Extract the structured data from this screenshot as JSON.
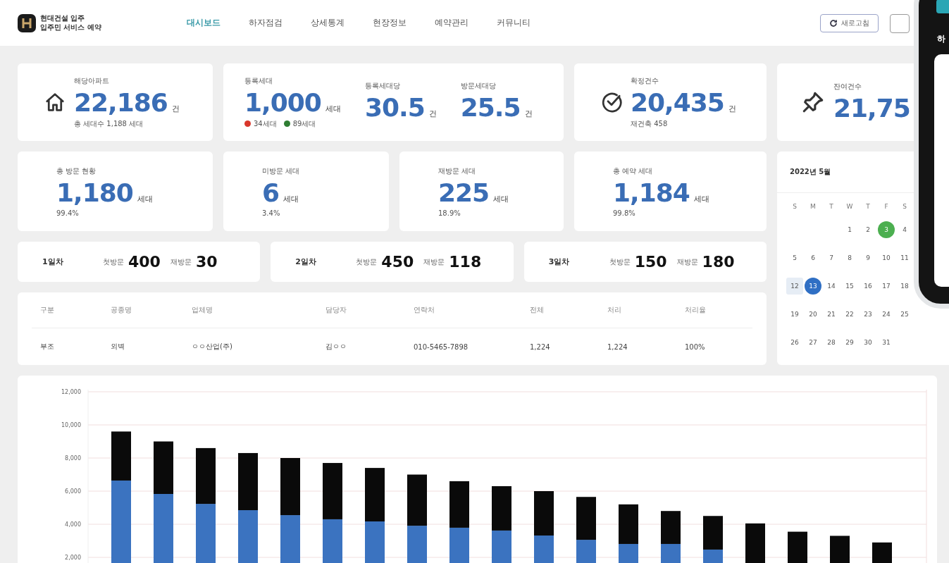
{
  "header": {
    "logo_lines": [
      "현대건설 입주",
      "입주민 서비스 예약"
    ],
    "nav": [
      {
        "label": "대시보드",
        "selected": true
      },
      {
        "label": "하자점검",
        "selected": false
      },
      {
        "label": "상세통계",
        "selected": false
      },
      {
        "label": "현장정보",
        "selected": false
      },
      {
        "label": "예약관리",
        "selected": false
      },
      {
        "label": "커뮤니티",
        "selected": false
      }
    ],
    "refresh_button": "새로고침"
  },
  "summary_cards": [
    {
      "kind": "home",
      "label": "해당아파트",
      "value": "22,186",
      "unit": "건",
      "note": "총 세대수 1,188 세대"
    },
    {
      "kind": "multi",
      "stats": [
        {
          "label": "등록세대",
          "value": "1,000",
          "unit": "세대"
        },
        {
          "label": "등록세대당",
          "value": "30.5",
          "unit": "건"
        },
        {
          "label": "방문세대당",
          "value": "25.5",
          "unit": "건"
        }
      ],
      "badges": [
        {
          "text": "34세대",
          "color": "#d9372b"
        },
        {
          "text": "89세대",
          "color": "#2e7d32"
        }
      ]
    },
    {
      "kind": "check",
      "label": "확정건수",
      "value": "20,435",
      "unit": "건",
      "note": "재건축 458"
    },
    {
      "kind": "pin",
      "label": "잔여건수",
      "value": "21,75"
    }
  ],
  "visit_cards": [
    {
      "label": "총 방문 현황",
      "value": "1,180",
      "unit": "세대",
      "percent": "99.4%"
    },
    {
      "label": "미방문 세대",
      "value": "6",
      "unit": "세대",
      "percent": "3.4%"
    },
    {
      "label": "재방문 세대",
      "value": "225",
      "unit": "세대",
      "percent": "18.9%"
    },
    {
      "label": "총 예약 세대",
      "value": "1,184",
      "unit": "세대",
      "percent": "99.8%"
    }
  ],
  "day_cards": [
    {
      "day": "1일차",
      "first_label": "첫방문",
      "first": "400",
      "re_label": "재방문",
      "re": "30"
    },
    {
      "day": "2일차",
      "first_label": "첫방문",
      "first": "450",
      "re_label": "재방문",
      "re": "118"
    },
    {
      "day": "3일차",
      "first_label": "첫방문",
      "first": "150",
      "re_label": "재방문",
      "re": "180"
    }
  ],
  "table": {
    "columns": [
      "구분",
      "공종명",
      "업체명",
      "담당자",
      "연락처",
      "전체",
      "처리",
      "처리율"
    ],
    "rows": [
      [
        "부조",
        "외벽",
        "ㅇㅇ산업(주)",
        "김ㅇㅇ",
        "010-5465-7898",
        "1,224",
        "1,224",
        "100%"
      ]
    ]
  },
  "calendar": {
    "title": "2022년 5월",
    "weekdays": [
      "S",
      "M",
      "T",
      "W",
      "T",
      "F",
      "S"
    ],
    "weeks": [
      [
        {
          "label": "1",
          "selected": false,
          "highlighted": false,
          "event": false
        },
        {
          "label": "2",
          "selected": false,
          "highlighted": false,
          "event": false
        },
        {
          "label": "3",
          "selected": false,
          "highlighted": false,
          "event": true
        },
        {
          "label": "4",
          "selected": false,
          "highlighted": false,
          "event": false
        }
      ],
      [
        {
          "label": "5",
          "selected": false,
          "highlighted": false,
          "event": false
        },
        {
          "label": "6",
          "selected": false,
          "highlighted": false,
          "event": false
        },
        {
          "label": "7",
          "selected": false,
          "highlighted": false,
          "event": false
        },
        {
          "label": "8",
          "selected": false,
          "highlighted": false,
          "event": false
        },
        {
          "label": "9",
          "selected": false,
          "highlighted": false,
          "event": false
        },
        {
          "label": "10",
          "selected": false,
          "highlighted": false,
          "event": false
        },
        {
          "label": "11",
          "selected": false,
          "highlighted": false,
          "event": false
        }
      ],
      [
        {
          "label": "12",
          "selected": false,
          "highlighted": true,
          "event": false
        },
        {
          "label": "13",
          "selected": true,
          "highlighted": false,
          "event": false
        },
        {
          "label": "14",
          "selected": false,
          "highlighted": false,
          "event": false
        },
        {
          "label": "15",
          "selected": false,
          "highlighted": false,
          "event": false
        },
        {
          "label": "16",
          "selected": false,
          "highlighted": false,
          "event": false
        },
        {
          "label": "17",
          "selected": false,
          "highlighted": false,
          "event": false
        },
        {
          "label": "18",
          "selected": false,
          "highlighted": false,
          "event": false
        }
      ],
      [
        {
          "label": "19",
          "selected": false,
          "highlighted": false,
          "event": false
        },
        {
          "label": "20",
          "selected": false,
          "highlighted": false,
          "event": false
        },
        {
          "label": "21",
          "selected": false,
          "highlighted": false,
          "event": false
        },
        {
          "label": "22",
          "selected": false,
          "highlighted": false,
          "event": false
        },
        {
          "label": "23",
          "selected": false,
          "highlighted": false,
          "event": false
        },
        {
          "label": "24",
          "selected": false,
          "highlighted": false,
          "event": false
        },
        {
          "label": "25",
          "selected": false,
          "highlighted": false,
          "event": false
        }
      ],
      [
        {
          "label": "26",
          "selected": false,
          "highlighted": false,
          "event": false
        },
        {
          "label": "27",
          "selected": false,
          "highlighted": false,
          "event": false
        },
        {
          "label": "28",
          "selected": false,
          "highlighted": false,
          "event": false
        },
        {
          "label": "29",
          "selected": false,
          "highlighted": false,
          "event": false
        },
        {
          "label": "30",
          "selected": false,
          "highlighted": false,
          "event": false
        },
        {
          "label": "31",
          "selected": false,
          "highlighted": false,
          "event": false
        }
      ]
    ]
  },
  "phone": {
    "heading": "하"
  },
  "chart": {
    "chart_data": {
      "type": "bar",
      "stacked": true,
      "grid": true,
      "ylim": [
        0,
        12000
      ],
      "yticks": [
        {
          "value": 2000,
          "label": "2,000"
        },
        {
          "value": 4000,
          "label": "4,000"
        },
        {
          "value": 6000,
          "label": "6,000"
        },
        {
          "value": 8000,
          "label": "8,000"
        },
        {
          "value": 10000,
          "label": "10,000"
        },
        {
          "value": 12000,
          "label": "12,000"
        }
      ],
      "series": [
        {
          "color": "#3b73c0",
          "values": [
            6640,
            5830,
            5230,
            4850,
            4550,
            4300,
            4170,
            3910,
            3790,
            3620,
            3320,
            3060,
            2810,
            2810,
            2470,
            null,
            null,
            null,
            null
          ]
        },
        {
          "color": "#0a0a0a",
          "values": [
            2960,
            3170,
            3370,
            3450,
            3450,
            3400,
            3230,
            3090,
            2810,
            2680,
            2680,
            2590,
            2390,
            1990,
            2030,
            4050,
            3550,
            3300,
            2900
          ]
        }
      ]
    }
  }
}
